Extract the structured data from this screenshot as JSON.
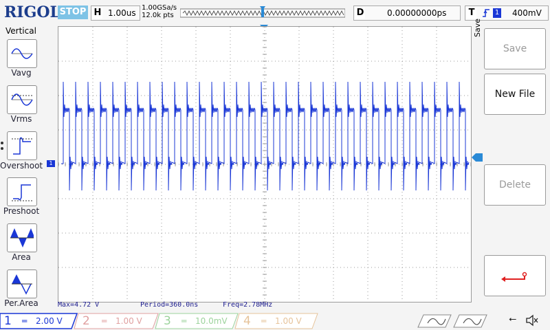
{
  "topbar": {
    "brand": "RIGOL",
    "status": "STOP",
    "timebase_label": "H",
    "timebase_value": "1.00us",
    "sample_rate": "1.00GSa/s",
    "memory_depth": "12.0k pts",
    "delay_label": "D",
    "delay_value": "0.00000000ps",
    "trigger_label": "T",
    "trigger_channel": "1",
    "trigger_level": "400mV"
  },
  "left_menu": {
    "title": "Vertical",
    "items": [
      {
        "label": "Vavg",
        "icon": "vavg-icon"
      },
      {
        "label": "Vrms",
        "icon": "vrms-icon"
      },
      {
        "label": "Overshoot",
        "icon": "overshoot-icon"
      },
      {
        "label": "Preshoot",
        "icon": "preshoot-icon"
      },
      {
        "label": "Area",
        "icon": "area-icon"
      },
      {
        "label": "Per.Area",
        "icon": "per-area-icon"
      }
    ]
  },
  "right_menu": {
    "title": "Save",
    "buttons": [
      {
        "label": "Save",
        "enabled": false
      },
      {
        "label": "New File",
        "enabled": true
      },
      {
        "label": "Delete",
        "enabled": false
      },
      {
        "label": "",
        "icon": "return-arrow-icon",
        "enabled": true
      }
    ]
  },
  "measurements": {
    "max": "Max=4.72 V",
    "period": "Period=360.0ns",
    "freq": "Freq=2.78MHz"
  },
  "channels": [
    {
      "num": "1",
      "scale": "2.00 V",
      "active": true,
      "color": "#1a37d6"
    },
    {
      "num": "2",
      "scale": "1.00 V",
      "active": false,
      "color": "#e0a0a0"
    },
    {
      "num": "3",
      "scale": "10.0mV",
      "active": false,
      "color": "#9cd39c"
    },
    {
      "num": "4",
      "scale": "1.00 V",
      "active": false,
      "color": "#e6c39a"
    }
  ],
  "colors": {
    "trace": "#1a37d6",
    "brand": "#1c3d8c",
    "status_bg": "#7ec3e6",
    "marker": "#2a8ad6"
  }
}
